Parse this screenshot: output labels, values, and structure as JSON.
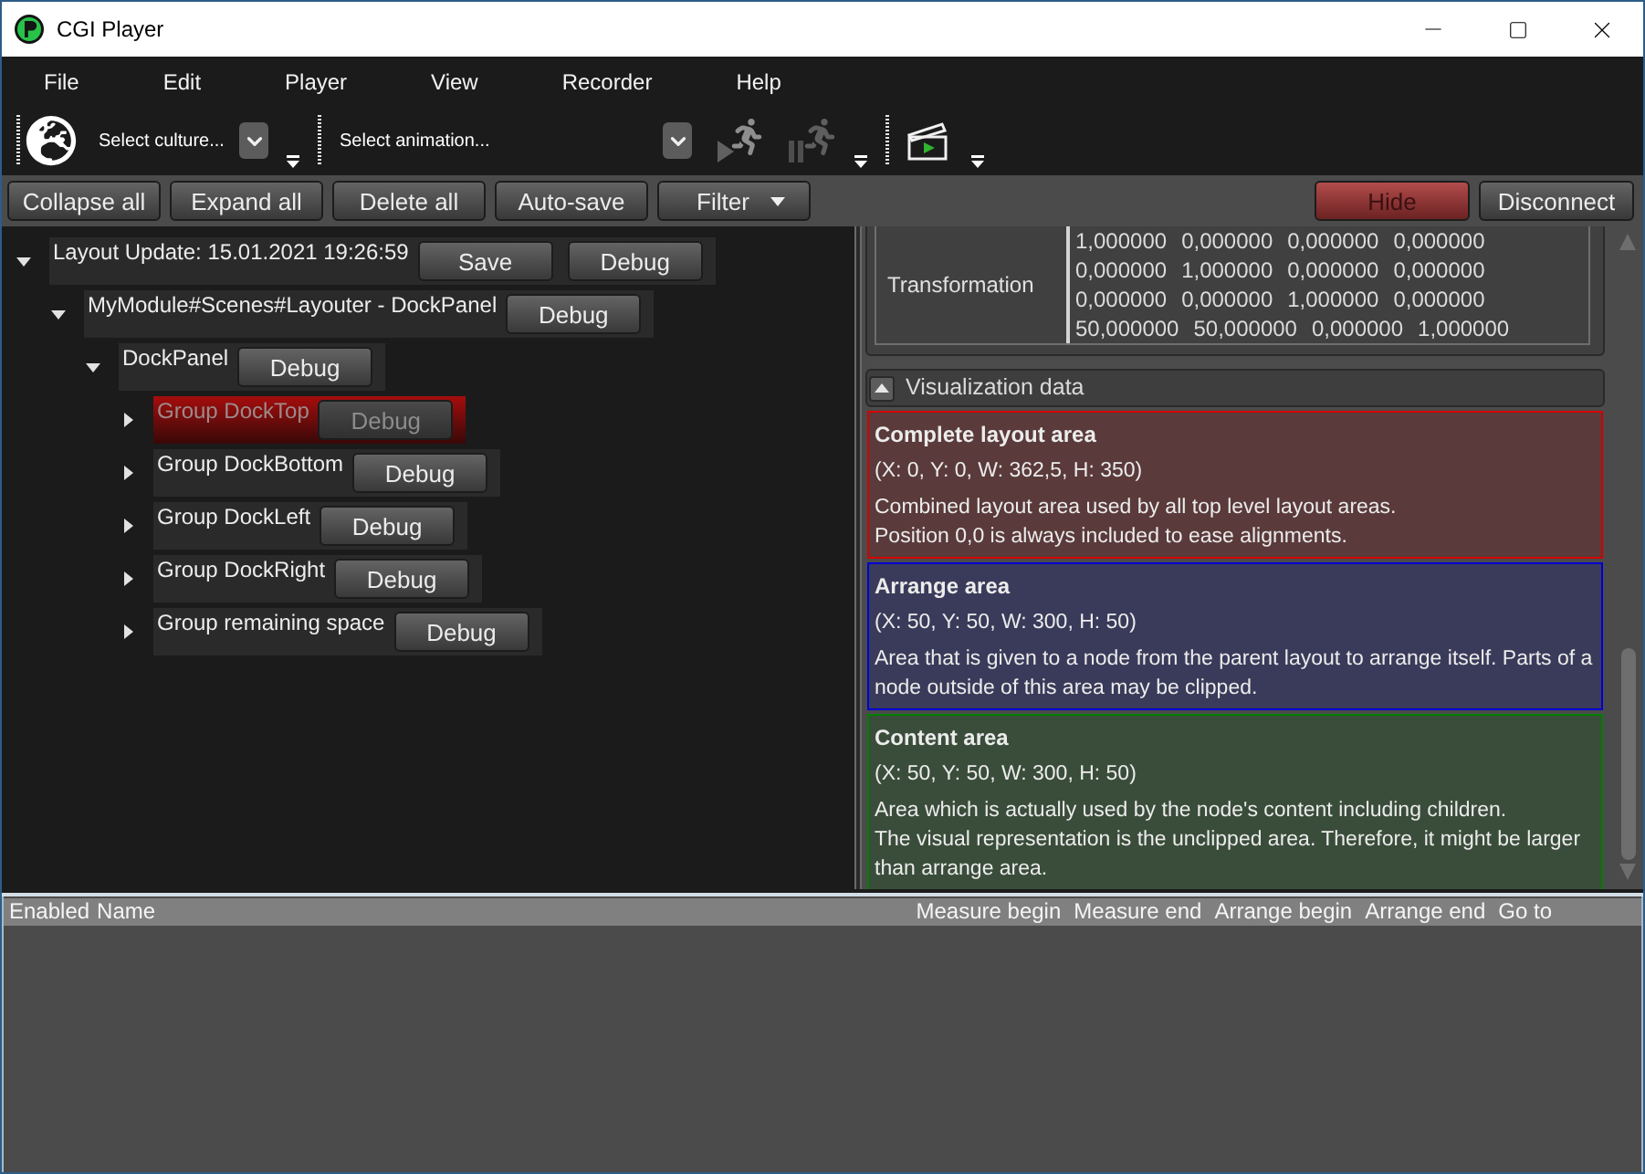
{
  "window": {
    "title": "CGI Player"
  },
  "menu": [
    "File",
    "Edit",
    "Player",
    "View",
    "Recorder",
    "Help"
  ],
  "toolbar": {
    "culture_select": {
      "placeholder": "Select culture..."
    },
    "animation_select": {
      "placeholder": "Select animation..."
    }
  },
  "actions": [
    {
      "label": "Collapse all",
      "kind": "button"
    },
    {
      "label": "Expand all",
      "kind": "button"
    },
    {
      "label": "Delete all",
      "kind": "button"
    },
    {
      "label": "Auto-save",
      "kind": "button"
    },
    {
      "label": "Filter",
      "kind": "dropdown"
    }
  ],
  "connection_actions": [
    {
      "label": "Hide",
      "kind": "danger"
    },
    {
      "label": "Disconnect",
      "kind": "button"
    }
  ],
  "tree": [
    {
      "label": "Layout Update: 15.01.2021 19:26:59",
      "expanded": true,
      "highlighted": false,
      "disabled": false,
      "buttons": [
        "Save",
        "Debug"
      ],
      "children": [
        {
          "label": "MyModule#Scenes#Layouter - DockPanel",
          "expanded": true,
          "highlighted": false,
          "disabled": false,
          "buttons": [
            "Debug"
          ],
          "children": [
            {
              "label": "DockPanel",
              "expanded": true,
              "highlighted": false,
              "disabled": false,
              "buttons": [
                "Debug"
              ],
              "children": [
                {
                  "label": "Group DockTop",
                  "expanded": false,
                  "highlighted": true,
                  "disabled": true,
                  "buttons": [
                    "Debug"
                  ]
                },
                {
                  "label": "Group DockBottom",
                  "expanded": false,
                  "highlighted": false,
                  "disabled": false,
                  "buttons": [
                    "Debug"
                  ]
                },
                {
                  "label": "Group DockLeft",
                  "expanded": false,
                  "highlighted": false,
                  "disabled": false,
                  "buttons": [
                    "Debug"
                  ]
                },
                {
                  "label": "Group DockRight",
                  "expanded": false,
                  "highlighted": false,
                  "disabled": false,
                  "buttons": [
                    "Debug"
                  ]
                },
                {
                  "label": "Group remaining space",
                  "expanded": false,
                  "highlighted": false,
                  "disabled": false,
                  "buttons": [
                    "Debug"
                  ]
                }
              ]
            }
          ]
        }
      ]
    }
  ],
  "properties": [
    {
      "name": "Transformation",
      "matrix": [
        [
          "1,000000",
          "0,000000",
          "0,000000",
          "0,000000"
        ],
        [
          "0,000000",
          "1,000000",
          "0,000000",
          "0,000000"
        ],
        [
          "0,000000",
          "0,000000",
          "1,000000",
          "0,000000"
        ],
        [
          "50,000000",
          "50,000000",
          "0,000000",
          "1,000000"
        ]
      ]
    }
  ],
  "visualization": {
    "title": "Visualization data",
    "expanded": true,
    "areas": [
      {
        "title": "Complete layout area",
        "rect": "(X: 0, Y: 0, W: 362,5, H: 350)",
        "lines": [
          "Combined layout area used by all top level layout areas.",
          "Position 0,0 is always included to ease alignments."
        ],
        "color": "#d40000"
      },
      {
        "title": "Arrange area",
        "rect": "(X: 50, Y: 50, W: 300, H: 50)",
        "lines": [
          "Area that is given to a node from the parent layout to arrange itself. Parts of a node outside of this area may be clipped."
        ],
        "color": "#0000d4"
      },
      {
        "title": "Content area",
        "rect": "(X: 50, Y: 50, W: 300, H: 50)",
        "lines": [
          "Area which is actually used by the node's content including children.",
          "The visual representation is the unclipped area. Therefore, it might be larger than arrange area."
        ],
        "color": "#008000"
      }
    ]
  },
  "table": {
    "columns": [
      "Enabled",
      "Name",
      "Measure begin",
      "Measure end",
      "Arrange begin",
      "Arrange end",
      "Go to"
    ]
  }
}
